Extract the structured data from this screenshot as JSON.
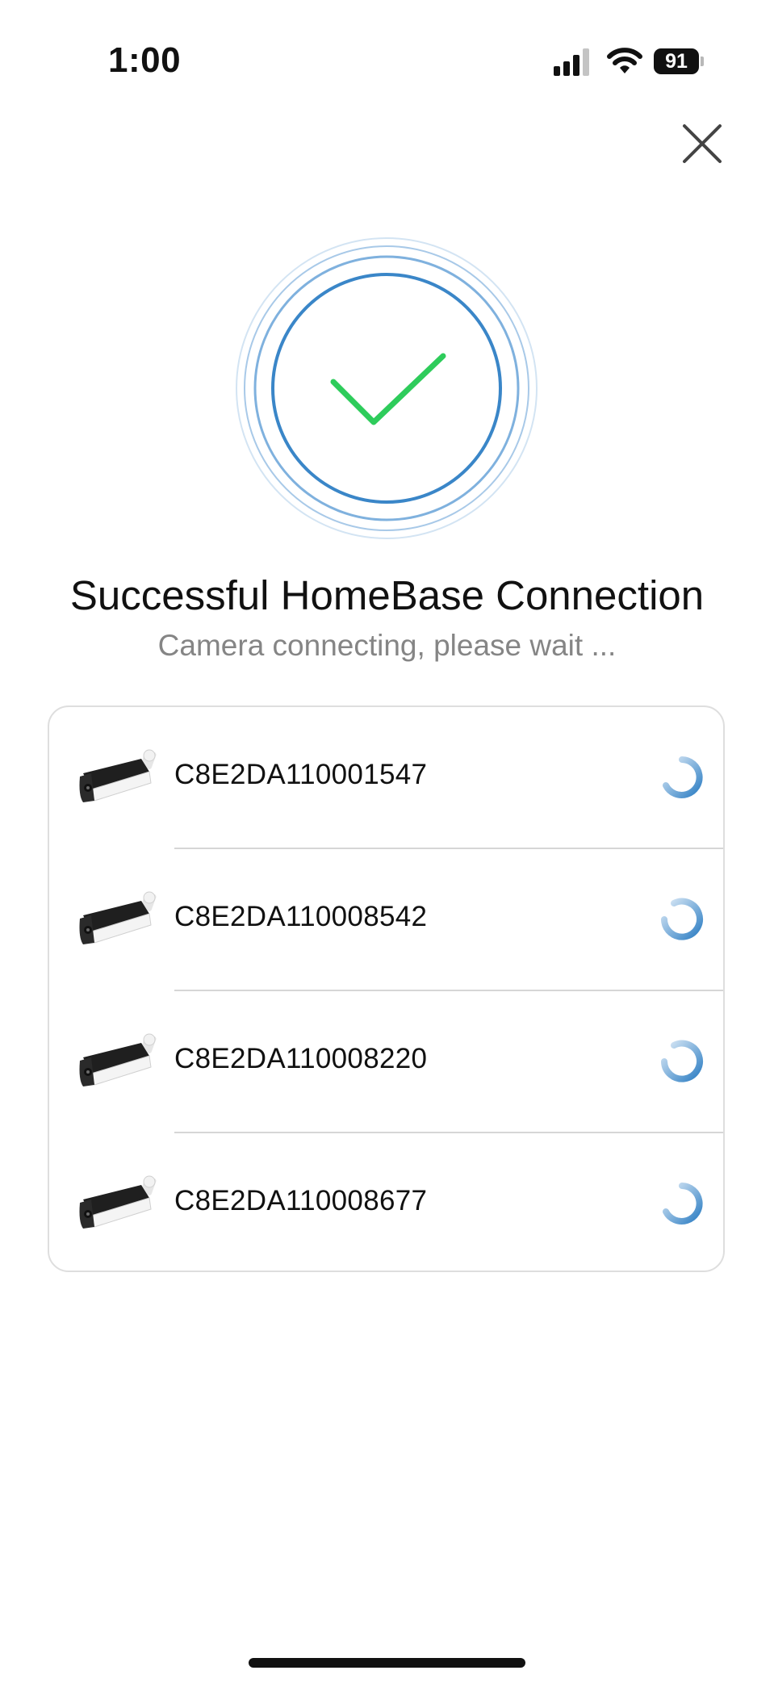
{
  "status_bar": {
    "time": "1:00",
    "battery": "91",
    "signal_icon": "cellular-signal-icon",
    "wifi_icon": "wifi-icon"
  },
  "header": {
    "close_icon": "close-icon"
  },
  "success": {
    "icon": "checkmark-icon",
    "check_color": "#2ecc5b",
    "ring_color": "#3a86c8",
    "title": "Successful HomeBase Connection",
    "subtitle": "Camera connecting, please wait ..."
  },
  "devices": [
    {
      "serial": "C8E2DA110001547",
      "icon": "camera-icon",
      "status_icon": "loading-spinner-icon"
    },
    {
      "serial": "C8E2DA110008542",
      "icon": "camera-icon",
      "status_icon": "loading-spinner-icon"
    },
    {
      "serial": "C8E2DA110008220",
      "icon": "camera-icon",
      "status_icon": "loading-spinner-icon"
    },
    {
      "serial": "C8E2DA110008677",
      "icon": "camera-icon",
      "status_icon": "loading-spinner-icon"
    }
  ]
}
